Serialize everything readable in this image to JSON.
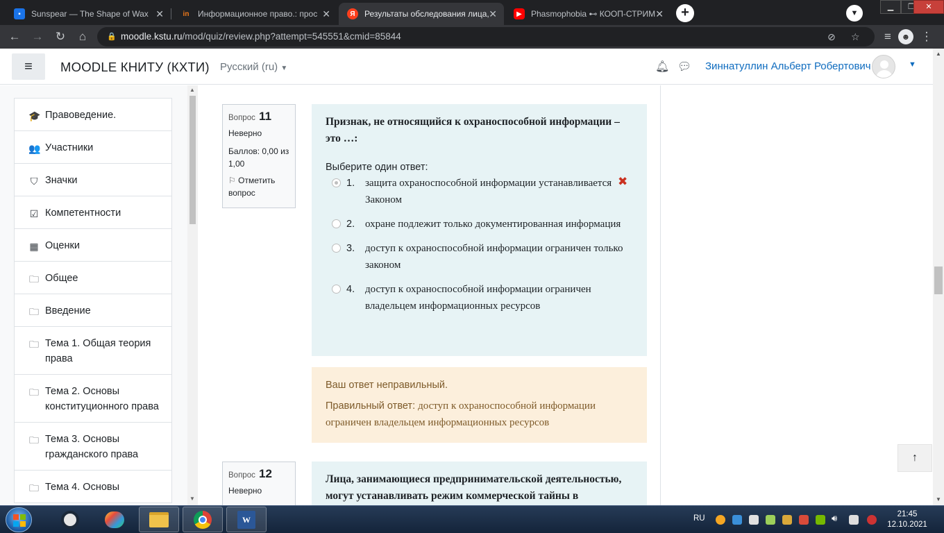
{
  "browser": {
    "tabs": [
      {
        "title": "Sunspear — The Shape of Wax",
        "favicon_color": "#1a73e8",
        "icon": "chat-bubble-icon"
      },
      {
        "title": "Информационное право.: прос",
        "favicon_color": "#f27a1a",
        "icon": "in-icon"
      },
      {
        "title": "Результаты обследования лица,",
        "favicon_color": "#fc3f1d",
        "icon": "yandex-icon"
      },
      {
        "title": "Phasmophobia ⊷ КООП-СТРИМ",
        "favicon_color": "#ff0000",
        "icon": "youtube-icon"
      }
    ],
    "url_host": "moodle.kstu.ru",
    "url_path": "/mod/quiz/review.php?attempt=545551&cmid=85844"
  },
  "header": {
    "site_name": "MOODLE КНИТУ (КХТИ)",
    "language": "Русский (ru)",
    "user_name": "Зиннатуллин Альберт Робертович"
  },
  "sidebar": {
    "items": [
      {
        "label": "Правоведение.",
        "icon": "graduation-cap-icon",
        "glyph": "🎓"
      },
      {
        "label": "Участники",
        "icon": "users-icon",
        "glyph": "👥"
      },
      {
        "label": "Значки",
        "icon": "shield-icon",
        "glyph": "⛉"
      },
      {
        "label": "Компетентности",
        "icon": "checkbox-icon",
        "glyph": "☑"
      },
      {
        "label": "Оценки",
        "icon": "table-icon",
        "glyph": "▦"
      },
      {
        "label": "Общее",
        "icon": "folder-icon",
        "glyph": "🗀"
      },
      {
        "label": "Введение",
        "icon": "folder-icon",
        "glyph": "🗀"
      },
      {
        "label": "Тема 1. Общая теория права",
        "icon": "folder-icon",
        "glyph": "🗀"
      },
      {
        "label": "Тема 2. Основы конституционного права",
        "icon": "folder-icon",
        "glyph": "🗀"
      },
      {
        "label": "Тема 3. Основы гражданского права",
        "icon": "folder-icon",
        "glyph": "🗀"
      },
      {
        "label": "Тема 4. Основы",
        "icon": "folder-icon",
        "glyph": "🗀"
      }
    ]
  },
  "questions": [
    {
      "label": "Вопрос",
      "number": "11",
      "state": "Неверно",
      "grade": "Баллов: 0,00 из 1,00",
      "flag": "Отметить вопрос",
      "text": "Признак, не относящийся к охраноспособной информации – это …:",
      "prompt": "Выберите один ответ:",
      "options": [
        {
          "num": "1.",
          "text": "защита охраноспособной информации устанавливается Законом",
          "selected": true,
          "wrong": true
        },
        {
          "num": "2.",
          "text": "охране подлежит только документированная информация",
          "selected": false,
          "wrong": false
        },
        {
          "num": "3.",
          "text": "доступ к охраноспособной информации ограничен только законом",
          "selected": false,
          "wrong": false
        },
        {
          "num": "4.",
          "text": "доступ к охраноспособной информации ограничен владельцем информационных ресурсов",
          "selected": false,
          "wrong": false
        }
      ],
      "feedback": "Ваш ответ неправильный.",
      "right_answer_label": "Правильный ответ:",
      "right_answer": "доступ к охраноспособной информации ограничен владельцем информационных ресурсов"
    },
    {
      "label": "Вопрос",
      "number": "12",
      "state": "Неверно",
      "text": "Лица, занимающиеся предпринимательской деятельностью, могут устанавливать режим коммерческой тайны в"
    }
  ],
  "taskbar": {
    "language": "RU",
    "time": "21:45",
    "date": "12.10.2021",
    "word_label": "W"
  },
  "colors": {
    "link": "#0f6cbf",
    "question_bg": "#e7f3f5",
    "feedback_bg": "#fcefdc",
    "wrong_mark": "#ca3120"
  }
}
